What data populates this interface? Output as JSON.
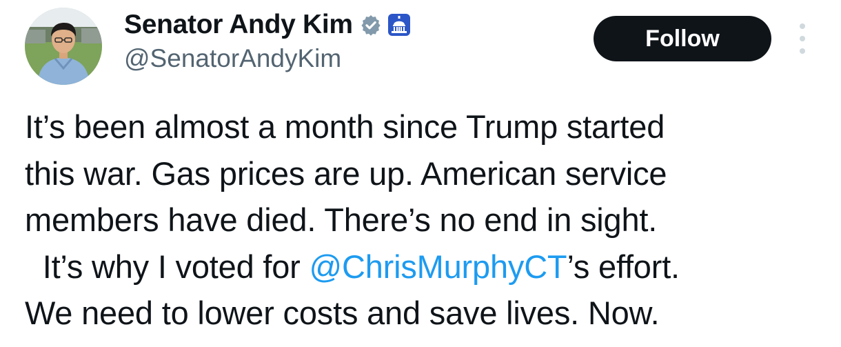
{
  "author": {
    "display_name": "Senator Andy Kim",
    "handle": "@SenatorAndyKim",
    "verified_icon": "verified-badge-icon",
    "affiliate_icon": "capitol-building-icon",
    "avatar_icon": "profile-photo"
  },
  "actions": {
    "follow_label": "Follow",
    "more_icon": "more-options-icon"
  },
  "tweet": {
    "line1": "It’s been almost a month since Trump started",
    "line2": "this war. Gas prices are up. American service",
    "line3": "members have died. There’s no end in sight.",
    "line4_prefix": "  It’s why I voted for ",
    "mention": "@ChrisMurphyCT",
    "line4_suffix": "’s effort.",
    "line5": "We need to lower costs and save lives. Now."
  },
  "colors": {
    "text": "#0f1419",
    "secondary": "#536471",
    "link": "#1d9bf0",
    "verified": "#829aab",
    "button_bg": "#0f1419",
    "button_text": "#ffffff"
  }
}
